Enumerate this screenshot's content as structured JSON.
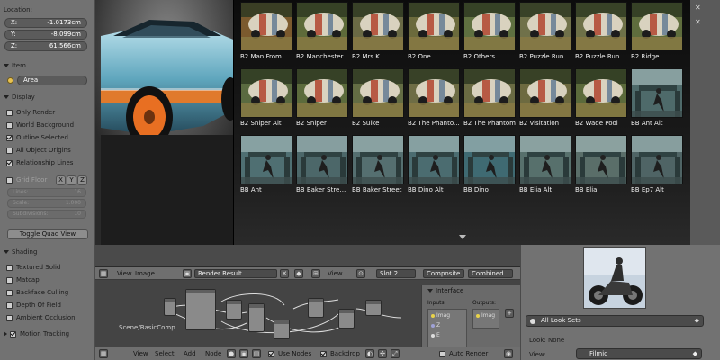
{
  "left_panel": {
    "location_header": "Location:",
    "location": [
      {
        "axis": "X:",
        "value": "-1.0173cm"
      },
      {
        "axis": "Y:",
        "value": "-8.099cm"
      },
      {
        "axis": "Z:",
        "value": "61.566cm"
      }
    ],
    "item_header": "Item",
    "item_name": "Area",
    "display_header": "Display",
    "display_options": [
      {
        "label": "Only Render",
        "checked": false
      },
      {
        "label": "World Background",
        "checked": false
      },
      {
        "label": "Outline Selected",
        "checked": true
      },
      {
        "label": "All Object Origins",
        "checked": false
      },
      {
        "label": "Relationship Lines",
        "checked": true
      }
    ],
    "grid_floor": {
      "label": "Grid Floor",
      "axes": [
        "X",
        "Y",
        "Z"
      ]
    },
    "grid_fields": [
      {
        "label": "Lines:",
        "value": "16"
      },
      {
        "label": "Scale:",
        "value": "1.000"
      },
      {
        "label": "Subdivisions:",
        "value": "10"
      }
    ],
    "toggle_quad_view": "Toggle Quad View",
    "shading_header": "Shading",
    "shading_options": [
      {
        "label": "Textured Solid",
        "checked": false
      },
      {
        "label": "Matcap",
        "checked": false
      },
      {
        "label": "Backface Culling",
        "checked": false
      },
      {
        "label": "Depth Of Field",
        "checked": false
      },
      {
        "label": "Ambient Occlusion",
        "checked": false
      }
    ],
    "motion_tracking": "Motion Tracking"
  },
  "gallery": {
    "items": [
      {
        "caption": "B2 Man From M...",
        "tint": "#7b5a2e"
      },
      {
        "caption": "B2 Manchester",
        "tint": "#5e6b3a"
      },
      {
        "caption": "B2 Mrs K",
        "tint": "#6a6a45"
      },
      {
        "caption": "B2 One",
        "tint": "#6b6a3c"
      },
      {
        "caption": "B2 Others",
        "tint": "#5f7040"
      },
      {
        "caption": "B2 Puzzle Run Alt",
        "tint": "#70714a"
      },
      {
        "caption": "B2 Puzzle Run",
        "tint": "#6e7148"
      },
      {
        "caption": "B2 Ridge",
        "tint": "#5f6d3d"
      },
      {
        "caption": "B2 Sniper Alt",
        "tint": "#5a6a40"
      },
      {
        "caption": "B2 Sniper",
        "tint": "#5c6b3c"
      },
      {
        "caption": "B2 Sulke",
        "tint": "#646d44"
      },
      {
        "caption": "B2 The Phanto...",
        "tint": "#6e6d45"
      },
      {
        "caption": "B2 The Phantom",
        "tint": "#6a6b43"
      },
      {
        "caption": "B2 Visitation",
        "tint": "#6d6a40"
      },
      {
        "caption": "B2 Wade Pool",
        "tint": "#5b6a3b"
      },
      {
        "caption": "BB Ant Alt",
        "tint": "#4e6a6a"
      },
      {
        "caption": "BB Ant",
        "tint": "#4f6f72"
      },
      {
        "caption": "BB Baker Street...",
        "tint": "#4c6769"
      },
      {
        "caption": "BB Baker Street",
        "tint": "#556f70"
      },
      {
        "caption": "BB Dino Alt",
        "tint": "#4b6c70"
      },
      {
        "caption": "BB Dino",
        "tint": "#3f6a72"
      },
      {
        "caption": "BB Elia Alt",
        "tint": "#57706c"
      },
      {
        "caption": "BB Elia",
        "tint": "#5a6e69"
      },
      {
        "caption": "BB Ep7 Alt",
        "tint": "#4f6465"
      }
    ]
  },
  "node_editor": {
    "menu": [
      "View",
      "Image"
    ],
    "image_name": "Render Result",
    "view_menu": "View",
    "slot": "Slot 2",
    "pass": "Composite",
    "combined": "Combined",
    "scene_label": "Scene/BasicComp",
    "footer": [
      "View",
      "Select",
      "Add",
      "Node"
    ],
    "use_nodes": "Use Nodes",
    "backdrop": "Backdrop",
    "auto_render": "Auto Render",
    "interface": {
      "title": "Interface",
      "inputs_label": "Inputs:",
      "outputs_label": "Outputs:",
      "inputs": [
        "Imag",
        "Z",
        "E"
      ],
      "outputs": [
        "Imag"
      ]
    }
  },
  "look_panel": {
    "lookset": "All Look Sets",
    "look_label": "Look: None",
    "view_label": "View:",
    "view_value": "Filmic"
  }
}
